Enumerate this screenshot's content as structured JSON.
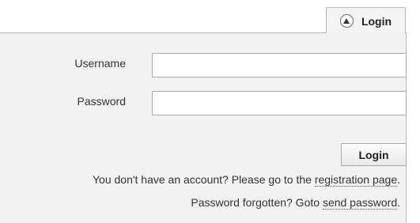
{
  "tab": {
    "label": "Login",
    "icon": "triangle-up-icon"
  },
  "form": {
    "username_label": "Username",
    "username_value": "",
    "password_label": "Password",
    "password_value": "",
    "submit_label": "Login"
  },
  "info": {
    "register_prefix": "You don't have an account? Please go to the ",
    "register_link": "registration page",
    "register_suffix": ".",
    "forgot_prefix": "Password forgotten? Goto ",
    "forgot_link": "send password",
    "forgot_suffix": "."
  }
}
